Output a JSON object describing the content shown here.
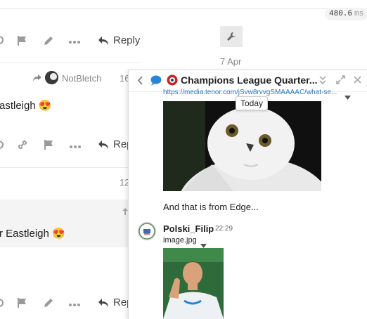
{
  "perf": {
    "value": "480.6",
    "unit": "ms"
  },
  "thread": {
    "reply_label": "Reply",
    "reply_label_truncated": "Rep",
    "date": "7 Apr",
    "post2": {
      "username": "NotBletch",
      "post_number_partial": "16",
      "text_partial": "astleigh",
      "emoji": "😍"
    },
    "post3": {
      "post_number_partial": "12",
      "text_partial": "r Eastleigh",
      "emoji": "😍"
    }
  },
  "chat": {
    "title": "Champions League Quarter...",
    "link_text": "https://media.tenor.com/jSvw8rvvgSMAAAAC/what-se...",
    "tooltip": "Today",
    "message1": "And that is from Edge...",
    "message2": {
      "username": "Polski_Filip",
      "time": "22:29",
      "filename": "image.jpg"
    }
  }
}
